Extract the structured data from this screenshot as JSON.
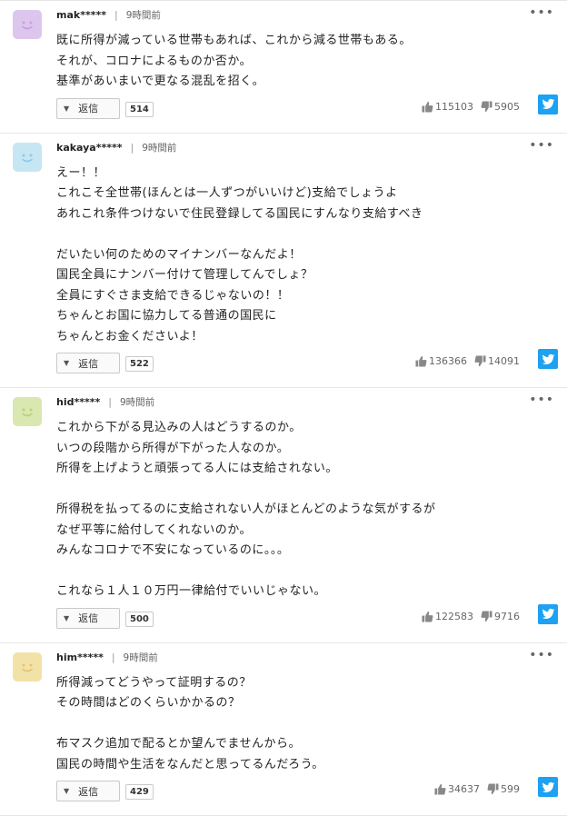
{
  "comments": [
    {
      "user": "mak*****",
      "time": "9時間前",
      "avatar_color": "#ddc6ee",
      "avatar_face": "#c8a0e0",
      "text": "既に所得が減っている世帯もあれば、これから減る世帯もある。\nそれが、コロナによるものか否か。\n基準があいまいで更なる混乱を招く。",
      "reply_label": "返信",
      "reply_count": "514",
      "likes": "115103",
      "dislikes": "5905"
    },
    {
      "user": "kakaya*****",
      "time": "9時間前",
      "avatar_color": "#c6e6f4",
      "avatar_face": "#8fcbe6",
      "text": "えー！！\nこれこそ全世帯(ほんとは一人ずつがいいけど)支給でしょうよ\nあれこれ条件つけないで住民登録してる国民にすんなり支給すべき\n\nだいたい何のためのマイナンバーなんだよ！\n国民全員にナンバー付けて管理してんでしょ？\n全員にすぐさま支給できるじゃないの！！\nちゃんとお国に協力してる普通の国民に\nちゃんとお金くださいよ！",
      "reply_label": "返信",
      "reply_count": "522",
      "likes": "136366",
      "dislikes": "14091"
    },
    {
      "user": "hid*****",
      "time": "9時間前",
      "avatar_color": "#d9e8b0",
      "avatar_face": "#b7d27a",
      "text": "これから下がる見込みの人はどうするのか。\nいつの段階から所得が下がった人なのか。\n所得を上げようと頑張ってる人には支給されない。\n\n所得税を払ってるのに支給されない人がほとんどのような気がするが\nなぜ平等に給付してくれないのか。\nみんなコロナで不安になっているのに。。。\n\nこれなら１人１０万円一律給付でいいじゃない。",
      "reply_label": "返信",
      "reply_count": "500",
      "likes": "122583",
      "dislikes": "9716"
    },
    {
      "user": "him*****",
      "time": "9時間前",
      "avatar_color": "#f3e2a8",
      "avatar_face": "#e0c670",
      "text": "所得減ってどうやって証明するの？\nその時間はどのくらいかかるの？\n\n布マスク追加で配るとか望んでませんから。\n国民の時間や生活をなんだと思ってるんだろう。",
      "reply_label": "返信",
      "reply_count": "429",
      "likes": "34637",
      "dislikes": "599"
    }
  ],
  "colors": {
    "twitter": "#1da1f2"
  }
}
